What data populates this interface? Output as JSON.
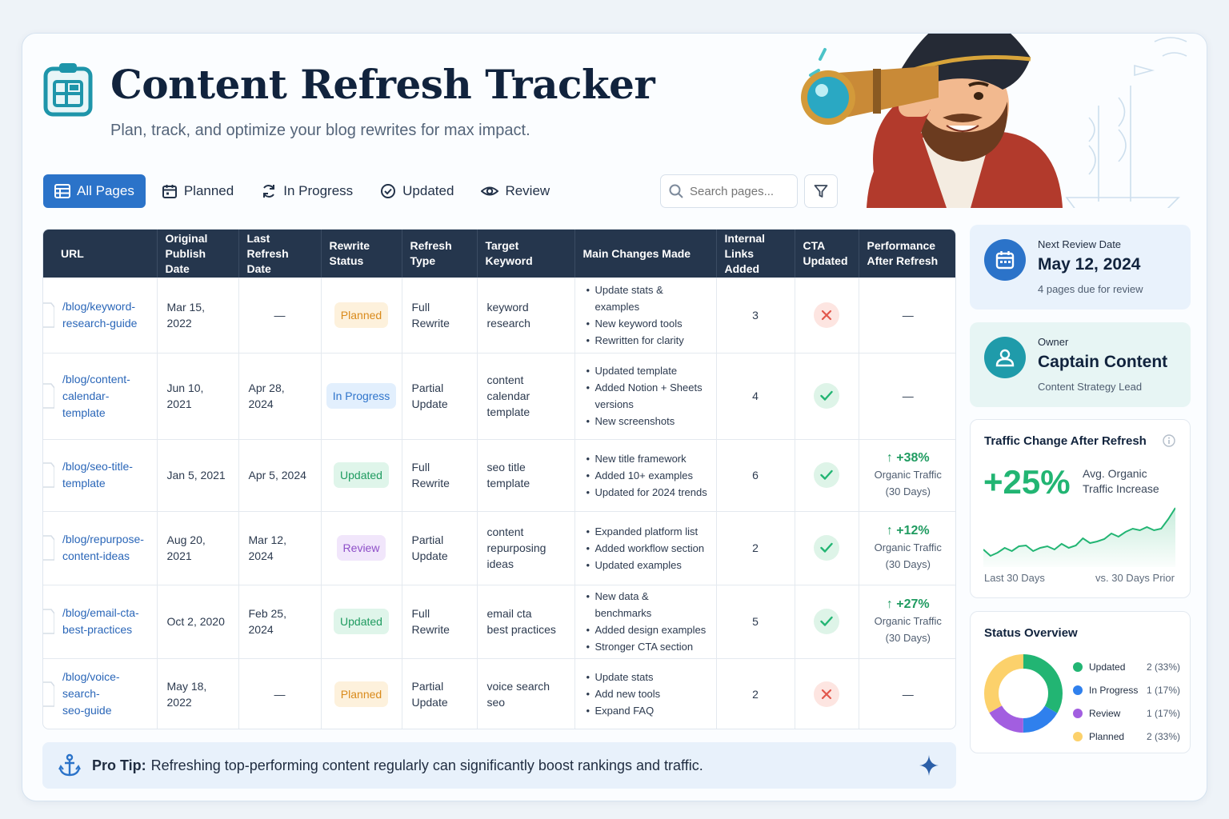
{
  "header": {
    "title": "Content Refresh Tracker",
    "subtitle": "Plan, track, and optimize your blog rewrites for max impact."
  },
  "tabs": [
    {
      "label": "All Pages",
      "icon": "table-icon",
      "active": true
    },
    {
      "label": "Planned",
      "icon": "calendar-icon"
    },
    {
      "label": "In Progress",
      "icon": "refresh-icon"
    },
    {
      "label": "Updated",
      "icon": "check-circle-icon"
    },
    {
      "label": "Review",
      "icon": "eye-icon"
    }
  ],
  "search": {
    "placeholder": "Search pages..."
  },
  "table": {
    "headers": [
      "URL",
      "Original Publish Date",
      "Last Refresh Date",
      "Rewrite Status",
      "Refresh Type",
      "Target Keyword",
      "Main Changes Made",
      "Internal Links Added",
      "CTA Updated",
      "Performance After Refresh"
    ],
    "header_lines": [
      [
        "URL"
      ],
      [
        "Original",
        "Publish Date"
      ],
      [
        "Last",
        "Refresh Date"
      ],
      [
        "Rewrite",
        "Status"
      ],
      [
        "Refresh",
        "Type"
      ],
      [
        "Target Keyword"
      ],
      [
        "Main Changes Made"
      ],
      [
        "Internal Links",
        "Added"
      ],
      [
        "CTA",
        "Updated"
      ],
      [
        "Performance",
        "After Refresh"
      ]
    ],
    "rows": [
      {
        "url": [
          "/blog/keyword-",
          "research-guide"
        ],
        "published": "Mar 15, 2022",
        "refreshed": "—",
        "status": "Planned",
        "status_key": "planned",
        "type": [
          "Full Rewrite"
        ],
        "keyword": [
          "keyword",
          "research"
        ],
        "changes": [
          "Update stats & examples",
          "New keyword tools",
          "Rewritten for clarity"
        ],
        "links": "3",
        "cta": false,
        "perf": null
      },
      {
        "url": [
          "/blog/content-",
          "calendar-template"
        ],
        "published": "Jun 10, 2021",
        "refreshed": "Apr 28, 2024",
        "status": "In Progress",
        "status_key": "progress",
        "type": [
          "Partial",
          "Update"
        ],
        "keyword": [
          "content",
          "calendar",
          "template"
        ],
        "changes": [
          "Updated template",
          "Added Notion + Sheets versions",
          "New screenshots"
        ],
        "links": "4",
        "cta": true,
        "perf": null
      },
      {
        "url": [
          "/blog/seo-title-",
          "template"
        ],
        "published": "Jan 5, 2021",
        "refreshed": "Apr 5, 2024",
        "status": "Updated",
        "status_key": "updated",
        "type": [
          "Full Rewrite"
        ],
        "keyword": [
          "seo title",
          "template"
        ],
        "changes": [
          "New title framework",
          "Added 10+ examples",
          "Updated for 2024 trends"
        ],
        "links": "6",
        "cta": true,
        "perf": {
          "value": "+38%",
          "label": "Organic Traffic",
          "period": "(30 Days)"
        }
      },
      {
        "url": [
          "/blog/repurpose-",
          "content-ideas"
        ],
        "published": "Aug 20, 2021",
        "refreshed": "Mar 12, 2024",
        "status": "Review",
        "status_key": "review",
        "type": [
          "Partial",
          "Update"
        ],
        "keyword": [
          "content",
          "repurposing",
          "ideas"
        ],
        "changes": [
          "Expanded platform list",
          "Added workflow section",
          "Updated examples"
        ],
        "links": "2",
        "cta": true,
        "perf": {
          "value": "+12%",
          "label": "Organic Traffic",
          "period": "(30 Days)"
        }
      },
      {
        "url": [
          "/blog/email-cta-",
          "best-practices"
        ],
        "published": "Oct 2, 2020",
        "refreshed": "Feb 25, 2024",
        "status": "Updated",
        "status_key": "updated",
        "type": [
          "Full Rewrite"
        ],
        "keyword": [
          "email cta",
          "best practices"
        ],
        "changes": [
          "New data & benchmarks",
          "Added design examples",
          "Stronger CTA section"
        ],
        "links": "5",
        "cta": true,
        "perf": {
          "value": "+27%",
          "label": "Organic Traffic",
          "period": "(30 Days)"
        }
      },
      {
        "url": [
          "/blog/voice-search-",
          "seo-guide"
        ],
        "published": "May 18, 2022",
        "refreshed": "—",
        "status": "Planned",
        "status_key": "planned",
        "type": [
          "Partial",
          "Update"
        ],
        "keyword": [
          "voice search",
          "seo"
        ],
        "changes": [
          "Update stats",
          "Add new tools",
          "Expand FAQ"
        ],
        "links": "2",
        "cta": false,
        "perf": null
      }
    ],
    "empty_placeholder": "—"
  },
  "protip": {
    "label": "Pro Tip:",
    "text": "Refreshing top-performing content regularly can significantly boost rankings and traffic."
  },
  "review": {
    "label": "Next Review Date",
    "date": "May 12, 2024",
    "note": "4 pages due for review"
  },
  "owner": {
    "label": "Owner",
    "name": "Captain Content",
    "role": "Content Strategy Lead"
  },
  "traffic": {
    "title": "Traffic Change After Refresh",
    "value": "+25%",
    "description": "Avg. Organic Traffic Increase",
    "axis_left": "Last 30 Days",
    "axis_right": "vs. 30 Days Prior",
    "trend": [
      38,
      46,
      42,
      36,
      40,
      34,
      33,
      40,
      36,
      34,
      38,
      31,
      36,
      33,
      24,
      30,
      28,
      25,
      18,
      22,
      16,
      12,
      14,
      10,
      14,
      12,
      0,
      -14
    ]
  },
  "status_overview": {
    "title": "Status Overview",
    "items": [
      {
        "label": "Updated",
        "count": "2 (33%)",
        "value": 2,
        "color": "#22b573"
      },
      {
        "label": "In Progress",
        "count": "1 (17%)",
        "value": 1,
        "color": "#2f80ed"
      },
      {
        "label": "Review",
        "count": "1 (17%)",
        "value": 1,
        "color": "#a25ee0"
      },
      {
        "label": "Planned",
        "count": "2 (33%)",
        "value": 2,
        "color": "#fcd16b"
      }
    ]
  },
  "colors": {
    "accent": "#2b73c9",
    "success": "#22b573",
    "danger": "#e2574c",
    "header_bg": "#25364d"
  }
}
